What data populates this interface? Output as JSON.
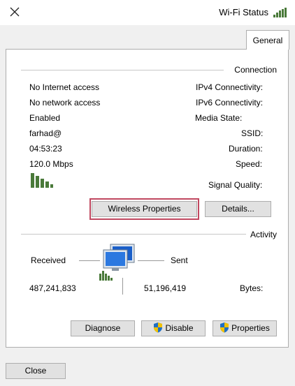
{
  "window": {
    "title": "Wi-Fi Status"
  },
  "tabs": [
    {
      "label": "General"
    }
  ],
  "connection": {
    "group_title": "Connection",
    "rows": [
      {
        "label": "IPv4 Connectivity:",
        "value": "No Internet access"
      },
      {
        "label": "IPv6 Connectivity:",
        "value": "No network access"
      },
      {
        "label": "Media State:",
        "value": "Enabled"
      },
      {
        "label": "SSID:",
        "value": "farhad@"
      },
      {
        "label": "Duration:",
        "value": "04:53:23"
      },
      {
        "label": "Speed:",
        "value": "120.0 Mbps"
      }
    ],
    "signal_label": "Signal Quality:",
    "signal_bars": 5,
    "details_label": "Details...",
    "wireless_label": "Wireless Properties"
  },
  "activity": {
    "group_title": "Activity",
    "sent_label": "Sent",
    "received_label": "Received",
    "bytes_label": "Bytes:",
    "bytes_sent": "51,196,419",
    "bytes_received": "487,241,833"
  },
  "buttons": {
    "properties": "Properties",
    "disable": "Disable",
    "diagnose": "Diagnose",
    "close": "Close"
  },
  "colors": {
    "shield_blue": "#1f6fc5",
    "shield_yellow": "#f2c200",
    "focus": "#c0475f",
    "signal": "#4a7a3a"
  }
}
